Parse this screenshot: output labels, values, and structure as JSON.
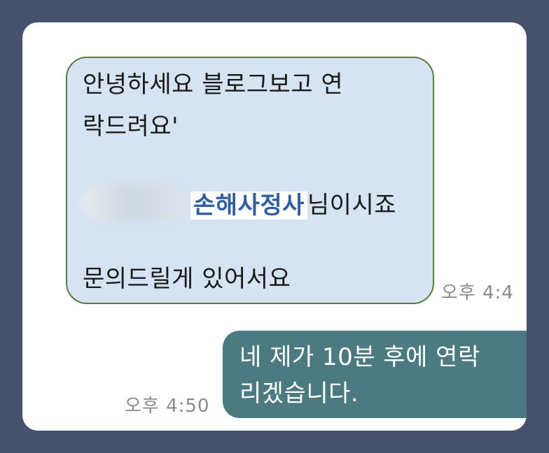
{
  "incoming_message": {
    "line1": "안녕하세요 블로그보고 연",
    "line2": "락드려요'",
    "company_name": "손해사정사",
    "name_suffix": "님이시죠",
    "line4": "문의드릴게 있어서요",
    "time": "오후 4:4"
  },
  "outgoing_message": {
    "line1": "네 제가 10분 후에 연락",
    "line2": "리겠습니다.",
    "time": "오후 4:50"
  },
  "colors": {
    "frame_background": "#47506c",
    "incoming_bubble": "#d6e3f3",
    "incoming_border": "#5a7a44",
    "outgoing_bubble": "#4b7b80",
    "highlight_text": "#2f5f9e",
    "timestamp": "#8a8a8a"
  }
}
